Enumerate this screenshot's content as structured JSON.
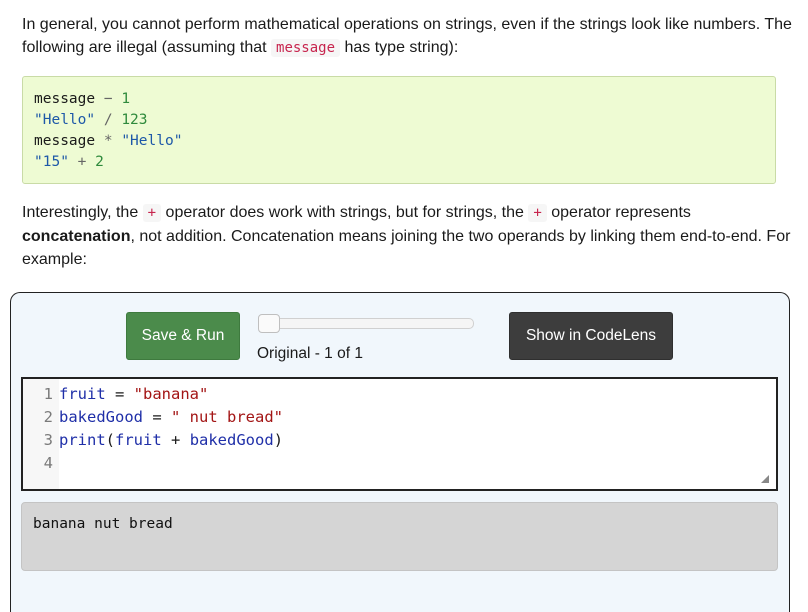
{
  "intro": {
    "part1": "In general, you cannot perform mathematical operations on strings, even if the strings look like numbers. The following are illegal (assuming that ",
    "inline_code": "message",
    "part2": " has type string):"
  },
  "illegal_examples": [
    [
      {
        "t": "name",
        "v": "message"
      },
      {
        "t": "sp",
        "v": " "
      },
      {
        "t": "op",
        "v": "−"
      },
      {
        "t": "sp",
        "v": " "
      },
      {
        "t": "num",
        "v": "1"
      }
    ],
    [
      {
        "t": "str",
        "v": "\"Hello\""
      },
      {
        "t": "sp",
        "v": " "
      },
      {
        "t": "op",
        "v": "/"
      },
      {
        "t": "sp",
        "v": " "
      },
      {
        "t": "num",
        "v": "123"
      }
    ],
    [
      {
        "t": "name",
        "v": "message"
      },
      {
        "t": "sp",
        "v": " "
      },
      {
        "t": "op",
        "v": "*"
      },
      {
        "t": "sp",
        "v": " "
      },
      {
        "t": "str",
        "v": "\"Hello\""
      }
    ],
    [
      {
        "t": "str",
        "v": "\"15\""
      },
      {
        "t": "sp",
        "v": " "
      },
      {
        "t": "op",
        "v": "+"
      },
      {
        "t": "sp",
        "v": " "
      },
      {
        "t": "num",
        "v": "2"
      }
    ]
  ],
  "concat_para": {
    "part1": "Interestingly, the ",
    "op1": "+",
    "part2": " operator does work with strings, but for strings, the ",
    "op2": "+",
    "part3": " operator represents ",
    "bold": "concatenation",
    "part4": ", not addition. Concatenation means joining the two operands by linking them end-to-end. For example:"
  },
  "activecode": {
    "run_label": "Save & Run",
    "codelens_label": "Show in CodeLens",
    "version_label": "Original - 1 of 1",
    "slider_position": 0,
    "code_lines": [
      {
        "num": "1",
        "tokens": [
          {
            "t": "var",
            "v": "fruit"
          },
          {
            "t": "op",
            "v": " = "
          },
          {
            "t": "str",
            "v": "\"banana\""
          }
        ]
      },
      {
        "num": "2",
        "tokens": [
          {
            "t": "var",
            "v": "bakedGood"
          },
          {
            "t": "op",
            "v": " = "
          },
          {
            "t": "str",
            "v": "\" nut bread\""
          }
        ]
      },
      {
        "num": "3",
        "tokens": [
          {
            "t": "builtin",
            "v": "print"
          },
          {
            "t": "op",
            "v": "("
          },
          {
            "t": "var",
            "v": "fruit"
          },
          {
            "t": "op",
            "v": " + "
          },
          {
            "t": "var",
            "v": "bakedGood"
          },
          {
            "t": "op",
            "v": ")"
          }
        ]
      },
      {
        "num": "4",
        "tokens": []
      }
    ],
    "output": "banana nut bread"
  },
  "colors": {
    "run_button": "#4b8b4b",
    "codelens_button": "#3d3d3d",
    "code_block_bg": "#eefbd3",
    "output_bg": "#d5d5d5"
  }
}
